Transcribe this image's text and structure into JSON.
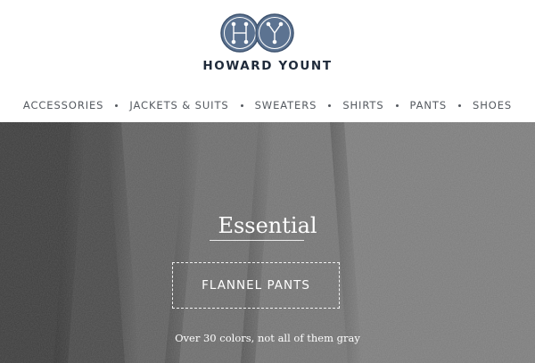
{
  "brand": {
    "monogram_left": "H",
    "monogram_right": "Y",
    "name": "HOWARD YOUNT",
    "colors": {
      "monogram_fill": "#5c7391",
      "text": "#1f2a3a"
    }
  },
  "nav": {
    "items": [
      {
        "label": "ACCESSORIES"
      },
      {
        "label": "JACKETS & SUITS"
      },
      {
        "label": "SWEATERS"
      },
      {
        "label": "SHIRTS"
      },
      {
        "label": "PANTS"
      },
      {
        "label": "SHOES"
      }
    ]
  },
  "hero": {
    "heading": "Essential",
    "cta_label": "FLANNEL PANTS",
    "tagline": "Over 30 colors, not all of them gray",
    "colors": {
      "fabric_dark": "#3a3a3a",
      "fabric_light": "#7d7d7d",
      "text": "#ffffff"
    }
  }
}
